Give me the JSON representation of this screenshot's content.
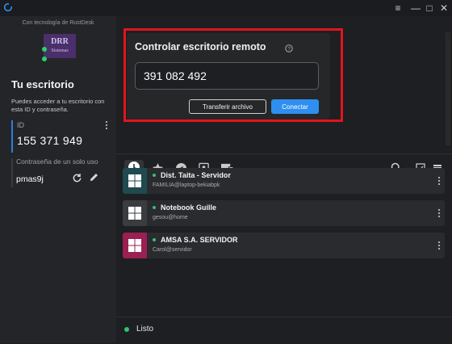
{
  "window": {
    "controls": {
      "menu": "≡",
      "minimize": "—",
      "maximize": "□",
      "close": "✕"
    }
  },
  "sidebar": {
    "powered_by": "Con tecnología de RustDesk",
    "brand_logo_text": "DRR Sistemas",
    "your_desktop_title": "Tu escritorio",
    "your_desktop_desc": "Puedes acceder a tu escritorio con esta ID y contraseña.",
    "id_label": "ID",
    "id_value": "155 371 949",
    "password_label": "Contraseña de un solo uso",
    "password_value": "pmas9j"
  },
  "remote": {
    "title": "Controlar escritorio remoto",
    "id_value": "391 082 492",
    "transfer_label": "Transferir archivo",
    "connect_label": "Conectar"
  },
  "tabs": [
    {
      "name": "recent-tab",
      "icon": "clock-icon",
      "active": true
    },
    {
      "name": "favorites-tab",
      "icon": "star-icon"
    },
    {
      "name": "discovered-tab",
      "icon": "compass-icon"
    },
    {
      "name": "address-book-tab",
      "icon": "contact-card-icon"
    },
    {
      "name": "group-tab",
      "icon": "devices-icon"
    }
  ],
  "peers": [
    {
      "name": "Dist. Taita - Servidor",
      "user": "FAMILIA@laptop-bekiabpk",
      "color": "#1f4a4f"
    },
    {
      "name": "Notebook Guille",
      "user": "gesou@home",
      "color": "#3b3c40"
    },
    {
      "name": "AMSA S.A. SERVIDOR",
      "user": "Carol@servidor",
      "color": "#9a1f52"
    }
  ],
  "status": {
    "text": "Listo"
  },
  "colors": {
    "accent": "#2f8ff0",
    "online": "#2ec56c",
    "highlight": "#e0151c"
  }
}
